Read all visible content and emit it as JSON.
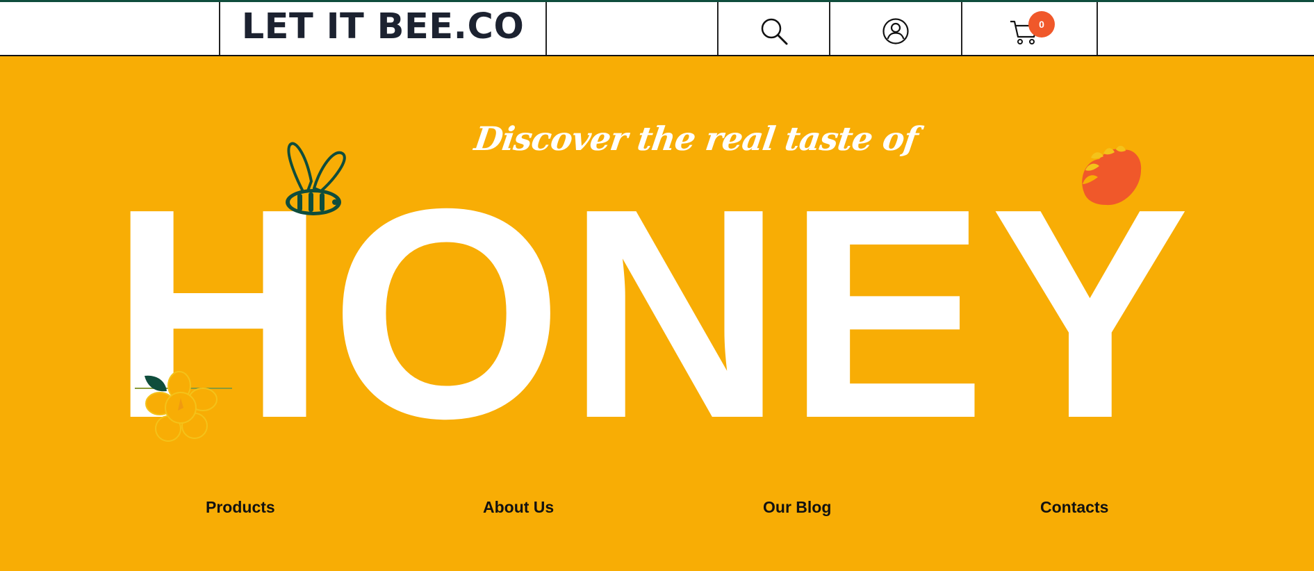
{
  "header": {
    "logo": "LET IT BEE.CO",
    "cart_count": "0",
    "icons": {
      "search": "search-icon",
      "account": "user-icon",
      "cart": "cart-icon"
    }
  },
  "hero": {
    "tagline": "Discover the real taste of",
    "headline": "HONEY",
    "decorations": [
      "bee-icon",
      "flower-icon",
      "orange-blossom-icon"
    ]
  },
  "nav": {
    "items": [
      {
        "label": "Products"
      },
      {
        "label": "About Us"
      },
      {
        "label": "Our Blog"
      },
      {
        "label": "Contacts"
      }
    ]
  },
  "colors": {
    "background": "#f8ad05",
    "accent_green": "#0f4d3c",
    "accent_orange": "#f0582a",
    "text_dark": "#1c2230"
  }
}
